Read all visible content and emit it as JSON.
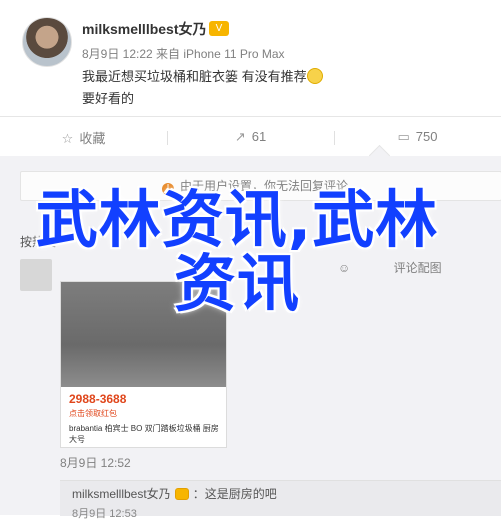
{
  "post": {
    "username": "milksmelllbest女乃",
    "meta": "8月9日 12:22 来自 iPhone 11 Pro Max",
    "content_line1": "我最近想买垃圾桶和脏衣篓 有没有推荐",
    "content_line2": "要好看的"
  },
  "actions": {
    "favorite_label": "收藏",
    "repost_count": "61",
    "comment_count": "750"
  },
  "comments": {
    "notice": "由于用户设置，你无法回复评论。",
    "header": "按热度",
    "report_label": "评论配图",
    "photo": {
      "price": "2988-3688",
      "tag": "点击领取红包",
      "desc": "brabantia 柏宾士 BO 双门踏板垃圾桶 厨房大号"
    },
    "time": "8月9日 12:52",
    "reply": {
      "username": "milksmelllbest女乃",
      "text": "：这是厨房的吧",
      "time": "8月9日 12:53"
    }
  },
  "watermark": "武林资讯,武林资讯"
}
